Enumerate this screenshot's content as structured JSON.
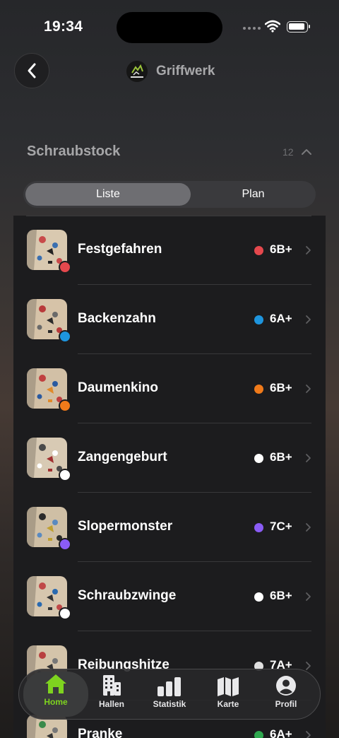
{
  "status_bar": {
    "time": "19:34"
  },
  "header": {
    "gym_name": "Griffwerk",
    "logo_text": "GRIFFWERK"
  },
  "section": {
    "title": "Schraubstock",
    "count": "12"
  },
  "segmented": {
    "list_label": "Liste",
    "plan_label": "Plan"
  },
  "routes": [
    {
      "name": "Festgefahren",
      "grade": "6B+",
      "color": "#e5484d"
    },
    {
      "name": "Backenzahn",
      "grade": "6A+",
      "color": "#1e95de"
    },
    {
      "name": "Daumenkino",
      "grade": "6B+",
      "color": "#f07a1a"
    },
    {
      "name": "Zangengeburt",
      "grade": "6B+",
      "color": "#ffffff"
    },
    {
      "name": "Slopermonster",
      "grade": "7C+",
      "color": "#8a5cf5"
    },
    {
      "name": "Schraubzwinge",
      "grade": "6B+",
      "color": "#ffffff"
    },
    {
      "name": "Reibungshitze",
      "grade": "7A+",
      "color": "#e0e0e0"
    },
    {
      "name": "Pranke",
      "grade": "6A+",
      "color": "#2fa84f"
    }
  ],
  "tabs": [
    {
      "label": "Home",
      "icon": "house-icon",
      "active": true
    },
    {
      "label": "Hallen",
      "icon": "building-icon",
      "active": false
    },
    {
      "label": "Statistik",
      "icon": "bar-chart-icon",
      "active": false
    },
    {
      "label": "Karte",
      "icon": "map-icon",
      "active": false
    },
    {
      "label": "Profil",
      "icon": "person-circle-icon",
      "active": false
    }
  ],
  "colors": {
    "accent": "#7ed31f",
    "background": "#1c1c1e"
  }
}
